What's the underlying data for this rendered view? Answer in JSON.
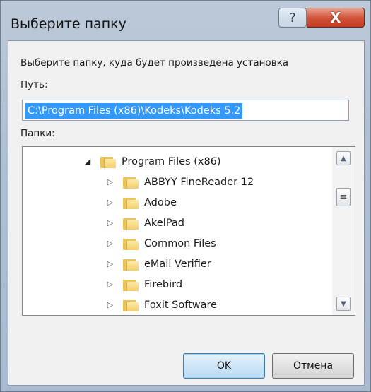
{
  "window": {
    "title": "Выберите папку",
    "help_glyph": "?",
    "close_glyph": "X"
  },
  "dialog": {
    "instruction": "Выберите папку, куда будет произведена установка",
    "path_label": "Путь:",
    "path_value": "C:\\Program Files (x86)\\Kodeks\\Kodeks 5.2",
    "folders_label": "Папки:"
  },
  "tree": {
    "root": {
      "label": "Program Files (x86)",
      "expanded": true
    },
    "children": [
      {
        "label": "ABBYY FineReader 12"
      },
      {
        "label": "Adobe"
      },
      {
        "label": "AkelPad"
      },
      {
        "label": "Common Files"
      },
      {
        "label": "eMail Verifier"
      },
      {
        "label": "Firebird"
      },
      {
        "label": "Foxit Software"
      }
    ],
    "expanded_arrow": "◢",
    "collapsed_arrow": "▷"
  },
  "scrollbar": {
    "up_glyph": "▲",
    "down_glyph": "▼",
    "thumb_glyph": "≡"
  },
  "buttons": {
    "ok_label": "OK",
    "cancel_label": "Отмена"
  },
  "colors": {
    "selection": "#3399ff",
    "close_button": "#c33a20"
  }
}
